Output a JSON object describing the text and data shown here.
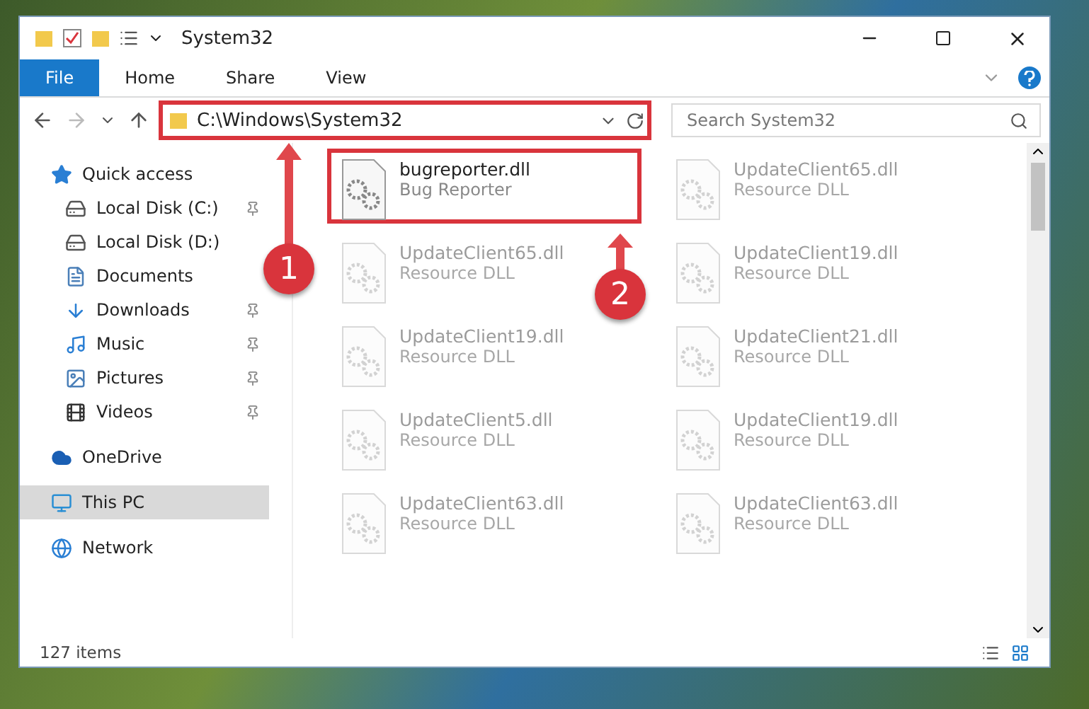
{
  "window": {
    "title": "System32"
  },
  "ribbon_tabs": [
    {
      "label": "File",
      "selected": true
    },
    {
      "label": "Home",
      "selected": false
    },
    {
      "label": "Share",
      "selected": false
    },
    {
      "label": "View",
      "selected": false
    }
  ],
  "address_bar": {
    "path": "C:\\Windows\\System32",
    "highlighted": true
  },
  "search": {
    "placeholder": "Search System32"
  },
  "sidebar": {
    "items": [
      {
        "label": "Quick access",
        "selected": false,
        "children": [
          {
            "label": "Local Disk (C:)",
            "pinned": true
          },
          {
            "label": "Local Disk (D:)",
            "pinned": false
          },
          {
            "label": "Documents",
            "pinned": false
          },
          {
            "label": "Downloads",
            "pinned": true
          },
          {
            "label": "Music",
            "pinned": true
          },
          {
            "label": "Pictures",
            "pinned": true
          },
          {
            "label": "Videos",
            "pinned": true
          }
        ]
      },
      {
        "label": "OneDrive",
        "selected": false
      },
      {
        "label": "This PC",
        "selected": true
      },
      {
        "label": "Network",
        "selected": false
      }
    ]
  },
  "files": [
    {
      "name": "bugreporter.dll",
      "type": "Bug Reporter",
      "highlighted": true,
      "dimmed": false
    },
    {
      "name": "UpdateClient65.dll",
      "type": "Resource DLL",
      "highlighted": false,
      "dimmed": true
    },
    {
      "name": "UpdateClient65.dll",
      "type": "Resource DLL",
      "highlighted": false,
      "dimmed": true
    },
    {
      "name": "UpdateClient19.dll",
      "type": "Resource DLL",
      "highlighted": false,
      "dimmed": true
    },
    {
      "name": "UpdateClient19.dll",
      "type": "Resource DLL",
      "highlighted": false,
      "dimmed": true
    },
    {
      "name": "UpdateClient21.dll",
      "type": "Resource DLL",
      "highlighted": false,
      "dimmed": true
    },
    {
      "name": "UpdateClient5.dll",
      "type": "Resource DLL",
      "highlighted": false,
      "dimmed": true
    },
    {
      "name": "UpdateClient19.dll",
      "type": "Resource DLL",
      "highlighted": false,
      "dimmed": true
    },
    {
      "name": "UpdateClient63.dll",
      "type": "Resource DLL",
      "highlighted": false,
      "dimmed": true
    },
    {
      "name": "UpdateClient63.dll",
      "type": "Resource DLL",
      "highlighted": false,
      "dimmed": true
    }
  ],
  "status_bar": {
    "count": "127 items"
  },
  "annotations": [
    {
      "label": "1"
    },
    {
      "label": "2"
    }
  ]
}
